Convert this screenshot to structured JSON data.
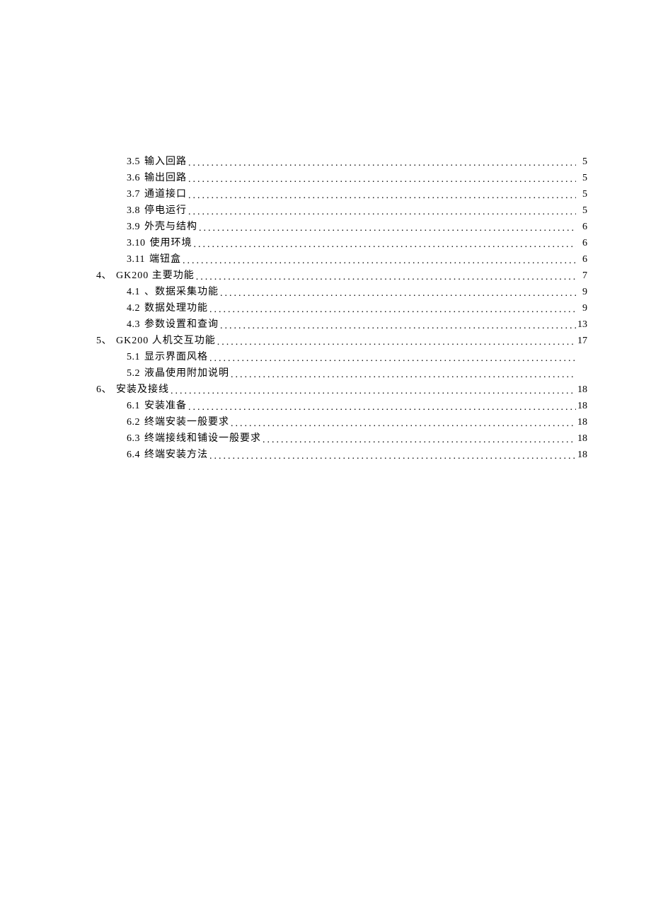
{
  "toc": [
    {
      "level": 1,
      "num": "3.5",
      "title": "输入回路",
      "page": "5"
    },
    {
      "level": 1,
      "num": "3.6",
      "title": "输出回路",
      "page": "5"
    },
    {
      "level": 1,
      "num": "3.7",
      "title": "通道接口",
      "page": "5"
    },
    {
      "level": 1,
      "num": "3.8",
      "title": "停电运行",
      "page": "5"
    },
    {
      "level": 1,
      "num": "3.9",
      "title": "外壳与结构",
      "page": "6"
    },
    {
      "level": 1,
      "num": "3.10",
      "title": " 使用环境",
      "page": "6"
    },
    {
      "level": 1,
      "num": "3.11",
      "title": " 端钮盒",
      "page": "6"
    },
    {
      "level": 0,
      "num": "4、",
      "title": "GK200 主要功能",
      "page": "7"
    },
    {
      "level": 1,
      "num": "4.1",
      "title": " 、数据采集功能",
      "page": "9"
    },
    {
      "level": 1,
      "num": "4.2",
      "title": "数据处理功能",
      "page": "9"
    },
    {
      "level": 1,
      "num": "4.3",
      "title": "参数设置和查询",
      "page": "13"
    },
    {
      "level": 0,
      "num": "5、",
      "title": "GK200 人机交互功能",
      "page": "17"
    },
    {
      "level": 1,
      "num": "5.1",
      "title": "显示界面风格",
      "page": ""
    },
    {
      "level": 1,
      "num": "5.2",
      "title": "液晶使用附加说明",
      "page": ""
    },
    {
      "level": 0,
      "num": "6、",
      "title": "安装及接线",
      "page": "18"
    },
    {
      "level": 1,
      "num": "6.1",
      "title": "安装准备",
      "page": "18"
    },
    {
      "level": 1,
      "num": "6.2",
      "title": "终端安装一般要求",
      "page": "18"
    },
    {
      "level": 1,
      "num": "6.3",
      "title": "终端接线和铺设一般要求",
      "page": "18"
    },
    {
      "level": 1,
      "num": "6.4",
      "title": "终端安装方法",
      "page": "18"
    }
  ]
}
